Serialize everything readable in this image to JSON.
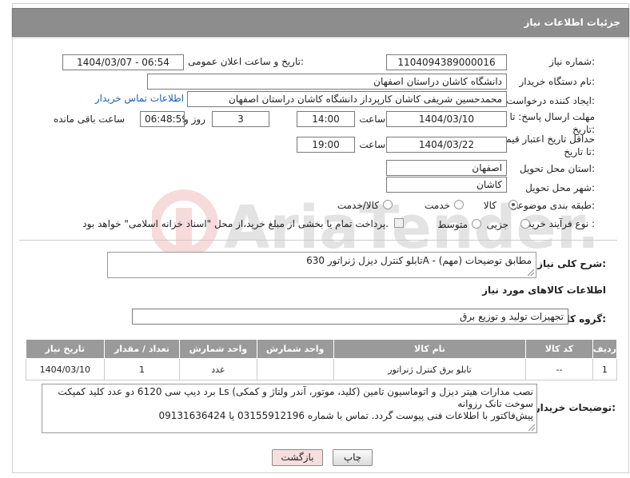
{
  "page": {
    "title": "جزئیات اطلاعات نیاز"
  },
  "form": {
    "need_number_label": "شماره نیاز:",
    "need_number": "1104094389000016",
    "announce_label": "تاریخ و ساعت اعلان عمومی:",
    "announce_value": "1404/03/07 - 06:54",
    "buyer_org_label": "نام دستگاه خریدار:",
    "buyer_org": "دانشگاه کاشان دراستان اصفهان",
    "requester_label": "ایجاد کننده درخواست:",
    "requester": "محمدحسین شریفی کاشان کارپرداز دانشگاه کاشان دراستان اصفهان",
    "contact_link": "اطلاعات تماس خریدار",
    "deadline_label": "مهلت ارسال پاسخ: تا تاریخ:",
    "deadline_date": "1404/03/10",
    "time_label": "ساعت",
    "deadline_time": "14:00",
    "days": "3",
    "days_label": "روز و",
    "remaining_time": "06:48:59",
    "remaining_label": "ساعت باقی مانده",
    "price_validity_label": "حداقل تاریخ اعتبار قیمت: تا تاریخ:",
    "price_validity_date": "1404/03/22",
    "price_validity_time": "19:00",
    "province_label": "استان محل تحویل:",
    "province": "اصفهان",
    "city_label": "شهر محل تحویل:",
    "city": "کاشان",
    "category_label": "طبقه بندی موضوعی:",
    "category_options": [
      "کالا",
      "خدمت",
      "کالا/خدمت"
    ],
    "category_selected": "کالا",
    "process_label": "نوع فرآیند خرید :",
    "process_options": [
      "جزیی",
      "متوسط"
    ],
    "payment_note": "پرداخت تمام یا بخشی از مبلغ خرید،از محل \"اسناد خزانه اسلامی\" خواهد بود.",
    "description_label": "شرح کلی نیاز:",
    "description": "تابلو کنترل دیزل ژنراتور 630A - مطابق توضیحات (مهم)"
  },
  "goods": {
    "section_title": "اطلاعات کالاهای مورد نیاز",
    "group_label": "گروه کالا:",
    "group_value": "تجهیزات تولید و توزیع برق",
    "columns": [
      "ردیف",
      "کد کالا",
      "نام کالا",
      "واحد شمارش",
      "تعداد / مقدار",
      "تاریخ نیاز"
    ],
    "rows": [
      [
        "1",
        "--",
        "تابلو برق کنترل ژنراتور",
        "عدد",
        "1",
        "1404/03/10"
      ]
    ]
  },
  "notes": {
    "label": "توضیحات خریدار:",
    "line1": "برد دیپ سی 6120 دو عدد کلید کمپکت Ls (کلید، موتور، آندر ولتاژ و کمکی) نصب مدارات هیتر دیزل و اتوماسیون تامین",
    "line2": "سوخت تانک رزوانه",
    "line3": "پیش‌فاکتور با اطلاعات فنی پیوست گردد. تماس با شماره 03155912196 یا 09131636424"
  },
  "buttons": {
    "print": "چاپ",
    "back": "بازگشت"
  },
  "colors": {
    "header": "#8d8d8d",
    "link": "#1a5fb4",
    "back_button_bg": "#f7dede"
  }
}
